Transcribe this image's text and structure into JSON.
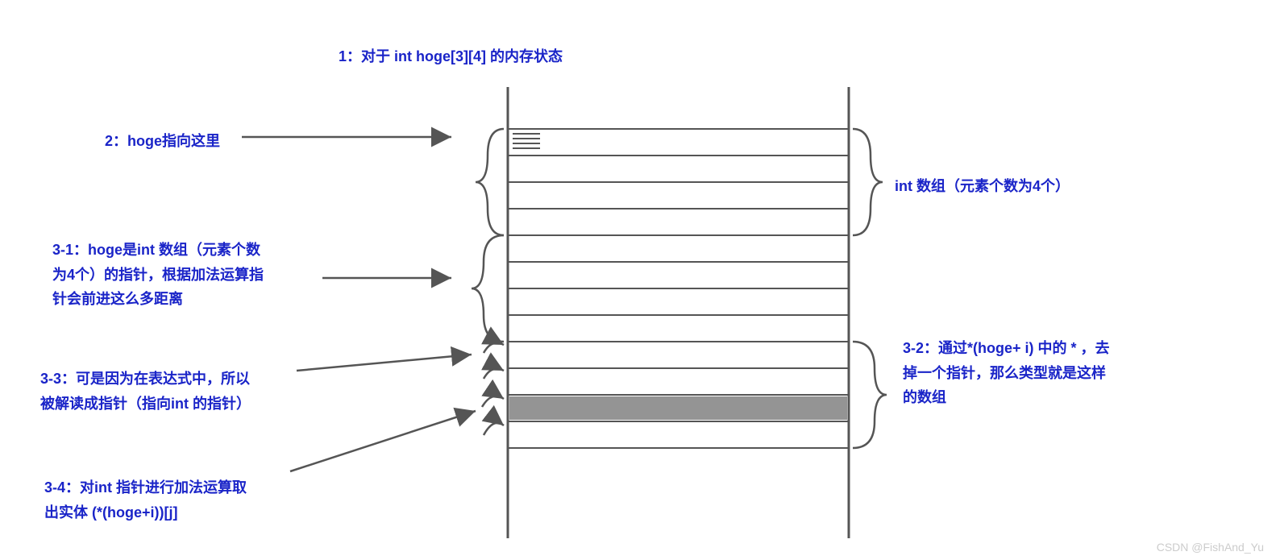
{
  "title": "1：对于 int hoge[3][4] 的内存状态",
  "labels": {
    "l2": "2：hoge指向这里",
    "l31_line1": "3-1：hoge是int 数组（元素个数",
    "l31_line2": "为4个）的指针，根据加法运算指",
    "l31_line3": "针会前进这么多距离",
    "l33_line1": "3-3：可是因为在表达式中，所以",
    "l33_line2": "被解读成指针（指向int 的指针）",
    "l34_line1": "3-4：对int 指针进行加法运算取",
    "l34_line2": "出实体 (*(hoge+i))[j]",
    "rA": "int 数组（元素个数为4个）",
    "l32_line1": "3-2：通过*(hoge+ i) 中的 * ，去",
    "l32_line2": "掉一个指针，那么类型就是这样",
    "l32_line3": "的数组"
  },
  "watermark": "CSDN @FishAnd_Yu"
}
